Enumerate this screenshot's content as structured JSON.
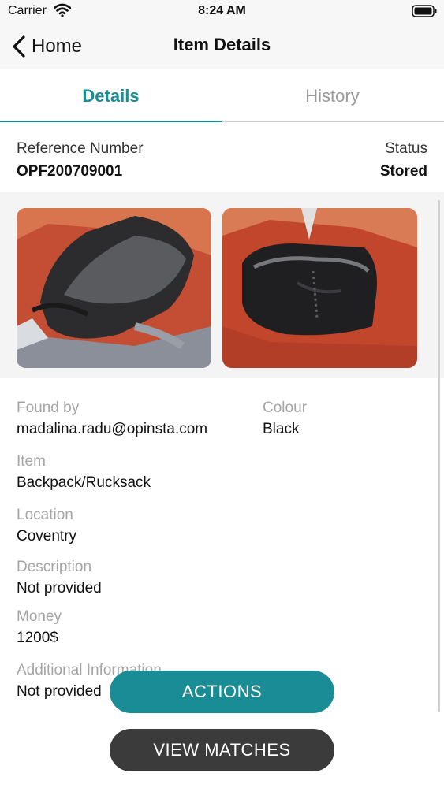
{
  "status_bar": {
    "carrier": "Carrier",
    "time": "8:24 AM",
    "wifi_icon": "wifi-icon",
    "battery_icon": "battery-icon"
  },
  "nav": {
    "back_label": "Home",
    "title": "Item Details"
  },
  "tabs": [
    {
      "label": "Details",
      "active": true
    },
    {
      "label": "History",
      "active": false
    }
  ],
  "summary": {
    "reference_label": "Reference Number",
    "reference_value": "OPF200709001",
    "status_label": "Status",
    "status_value": "Stored"
  },
  "fields": {
    "found_by_label": "Found by",
    "found_by_value": "madalina.radu@opinsta.com",
    "colour_label": "Colour",
    "colour_value": "Black",
    "item_label": "Item",
    "item_value": "Backpack/Rucksack",
    "location_label": "Location",
    "location_value": "Coventry",
    "description_label": "Description",
    "description_value": "Not provided",
    "money_label": "Money",
    "money_value": "1200$",
    "additional_label": "Additional Information",
    "additional_value": "Not provided"
  },
  "buttons": {
    "actions": "ACTIONS",
    "view_matches": "VIEW MATCHES"
  },
  "colors": {
    "accent": "#1a8d95",
    "actions_button": "#198c95",
    "matches_button": "#3b3b3b"
  }
}
